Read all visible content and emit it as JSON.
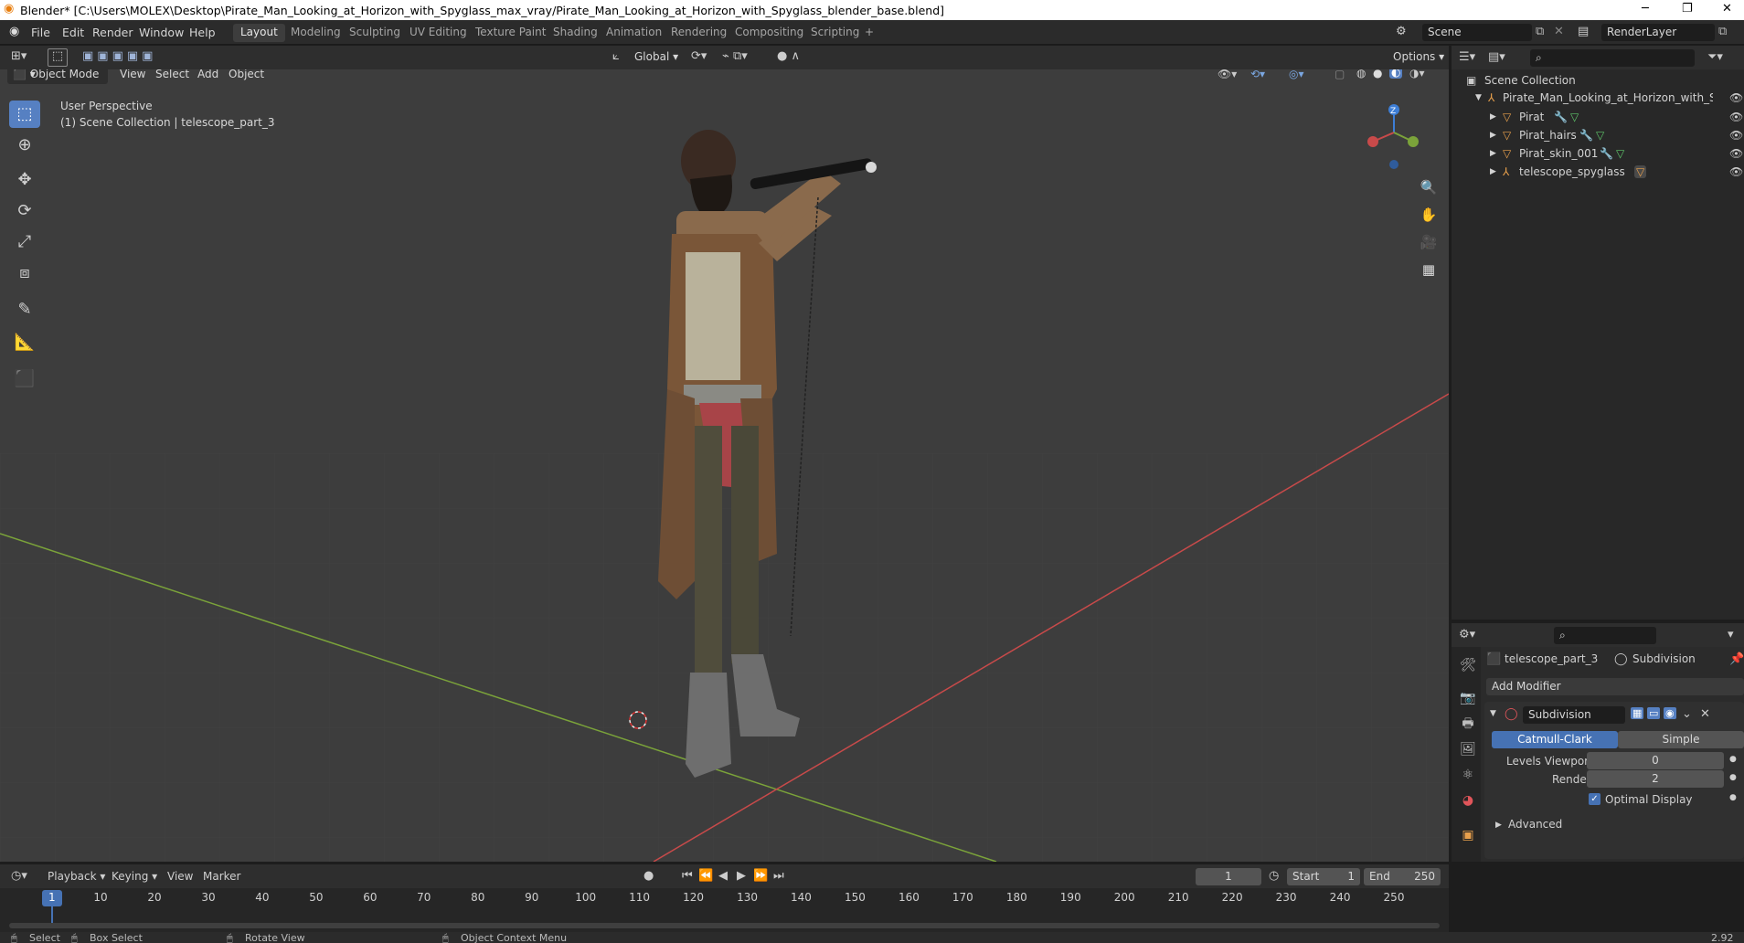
{
  "window": {
    "title": "Blender* [C:\\Users\\MOLEX\\Desktop\\Pirate_Man_Looking_at_Horizon_with_Spyglass_max_vray/Pirate_Man_Looking_at_Horizon_with_Spyglass_blender_base.blend]"
  },
  "menu": {
    "file": "File",
    "edit": "Edit",
    "render": "Render",
    "window": "Window",
    "help": "Help"
  },
  "workspaces": [
    "Layout",
    "Modeling",
    "Sculpting",
    "UV Editing",
    "Texture Paint",
    "Shading",
    "Animation",
    "Rendering",
    "Compositing",
    "Scripting"
  ],
  "topright": {
    "scene": "Scene",
    "render_layer": "RenderLayer"
  },
  "toolbar": {
    "orientation": "Global",
    "options": "Options"
  },
  "viewport": {
    "mode": "Object Mode",
    "menus": [
      "View",
      "Select",
      "Add",
      "Object"
    ],
    "perspective": "User Perspective",
    "collection_info": "(1) Scene Collection | telescope_part_3",
    "gizmo": {
      "z": "Z"
    }
  },
  "outliner": {
    "root": "Scene Collection",
    "collection": "Pirate_Man_Looking_at_Horizon_with_Spyglass",
    "items": [
      "Pirat",
      "Pirat_hairs",
      "Pirat_skin_001",
      "telescope_spyglass"
    ]
  },
  "properties": {
    "object": "telescope_part_3",
    "modifier_context": "Subdivision",
    "add_modifier": "Add Modifier",
    "modifier_name": "Subdivision",
    "catmull": "Catmull-Clark",
    "simple": "Simple",
    "levels_viewport_label": "Levels Viewport",
    "levels_viewport_value": "0",
    "render_label": "Render",
    "render_value": "2",
    "optimal_display": "Optimal Display",
    "advanced": "Advanced"
  },
  "timeline": {
    "menus": [
      "Playback",
      "Keying",
      "View",
      "Marker"
    ],
    "current_frame": "1",
    "start_label": "Start",
    "start_value": "1",
    "end_label": "End",
    "end_value": "250",
    "ticks": [
      "1",
      "10",
      "20",
      "30",
      "40",
      "50",
      "60",
      "70",
      "80",
      "90",
      "100",
      "110",
      "120",
      "130",
      "140",
      "150",
      "160",
      "170",
      "180",
      "190",
      "200",
      "210",
      "220",
      "230",
      "240",
      "250"
    ]
  },
  "status": {
    "select": "Select",
    "box_select": "Box Select",
    "rotate_view": "Rotate View",
    "context_menu": "Object Context Menu",
    "version": "2.92"
  },
  "colors": {
    "accent": "#5680c2",
    "x_axis": "#c84a4a",
    "y_axis": "#7ba33a",
    "z_axis": "#3d7ed6",
    "viewport_bg": "#3d3d3d"
  }
}
